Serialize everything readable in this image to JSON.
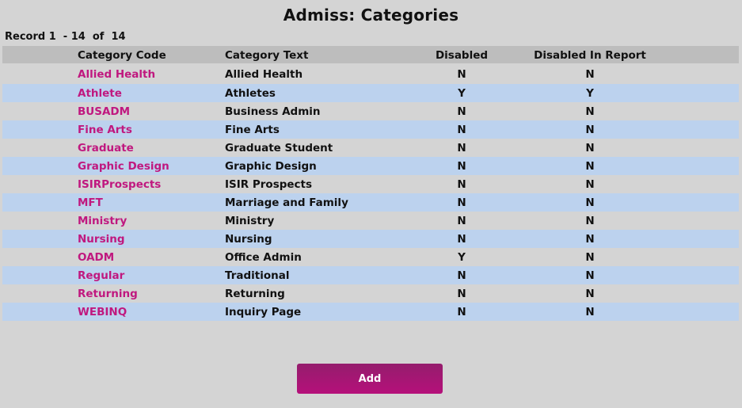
{
  "page": {
    "title": "Admiss: Categories",
    "record_count": "Record 1  - 14  of  14"
  },
  "table": {
    "columns": [
      "Category Code",
      "Category Text",
      "Disabled",
      "Disabled In Report"
    ],
    "rows": [
      {
        "code": "Allied Health",
        "text": "Allied Health",
        "disabled": "N",
        "disabled_in_report": "N"
      },
      {
        "code": "Athlete",
        "text": "Athletes",
        "disabled": "Y",
        "disabled_in_report": "Y"
      },
      {
        "code": "BUSADM",
        "text": "Business Admin",
        "disabled": "N",
        "disabled_in_report": "N"
      },
      {
        "code": "Fine Arts",
        "text": "Fine Arts",
        "disabled": "N",
        "disabled_in_report": "N"
      },
      {
        "code": "Graduate",
        "text": "Graduate Student",
        "disabled": "N",
        "disabled_in_report": "N"
      },
      {
        "code": "Graphic Design",
        "text": "Graphic Design",
        "disabled": "N",
        "disabled_in_report": "N"
      },
      {
        "code": "ISIRProspects",
        "text": "ISIR Prospects",
        "disabled": "N",
        "disabled_in_report": "N"
      },
      {
        "code": "MFT",
        "text": "Marriage and Family",
        "disabled": "N",
        "disabled_in_report": "N"
      },
      {
        "code": "Ministry",
        "text": "Ministry",
        "disabled": "N",
        "disabled_in_report": "N"
      },
      {
        "code": "Nursing",
        "text": "Nursing",
        "disabled": "N",
        "disabled_in_report": "N"
      },
      {
        "code": "OADM",
        "text": "Office Admin",
        "disabled": "Y",
        "disabled_in_report": "N"
      },
      {
        "code": "Regular",
        "text": "Traditional",
        "disabled": "N",
        "disabled_in_report": "N"
      },
      {
        "code": "Returning",
        "text": "Returning",
        "disabled": "N",
        "disabled_in_report": "N"
      },
      {
        "code": "WEBINQ",
        "text": "Inquiry Page",
        "disabled": "N",
        "disabled_in_report": "N"
      }
    ]
  },
  "actions": {
    "add_label": "Add"
  },
  "colors": {
    "background": "#d4d4d4",
    "header_bg": "#bdbdbd",
    "alt_row_bg": "#bcd2ee",
    "link": "#c0187f",
    "button": "#b5107a"
  }
}
